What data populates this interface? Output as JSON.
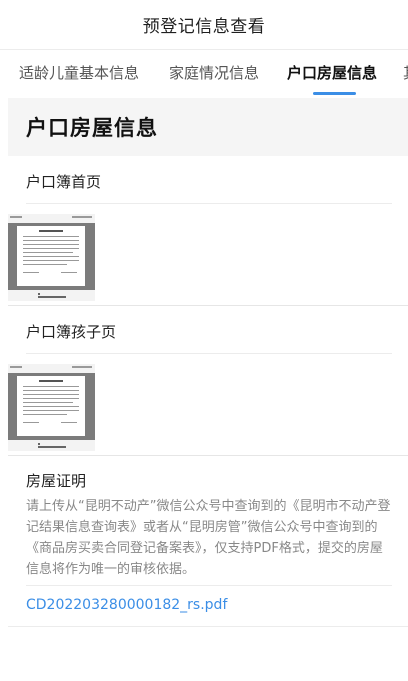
{
  "header": {
    "title": "预登记信息查看"
  },
  "tabs": [
    {
      "label": "适龄儿童基本信息",
      "active": false
    },
    {
      "label": "家庭情况信息",
      "active": false
    },
    {
      "label": "户口房屋信息",
      "active": true
    },
    {
      "label": "其",
      "active": false
    }
  ],
  "section": {
    "title": "户口房屋信息"
  },
  "hukou_first_page": {
    "label": "户口簿首页"
  },
  "hukou_child_page": {
    "label": "户口簿孩子页"
  },
  "property": {
    "label": "房屋证明",
    "description": "请上传从“昆明不动产”微信公众号中查询到的《昆明市不动产登记结果信息查询表》或者从“昆明房管”微信公众号中查询到的《商品房买卖合同登记备案表》，仅支持PDF格式，提交的房屋信息将作为唯一的审核依据。",
    "file_name": "CD202203280000182_rs.pdf"
  },
  "colors": {
    "accent": "#3b8ee6",
    "section_bg": "#f5f5f5"
  }
}
